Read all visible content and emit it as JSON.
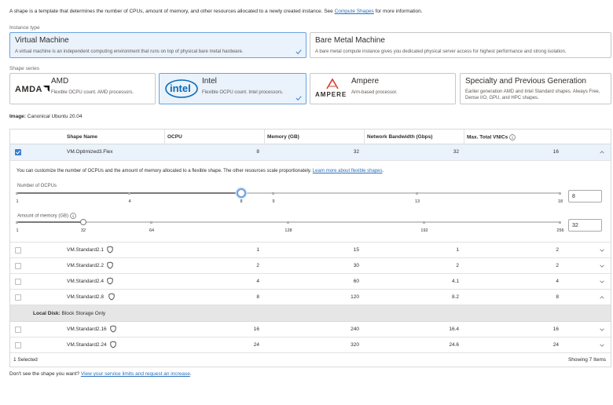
{
  "intro": {
    "text": "A shape is a template that determines the number of CPUs, amount of memory, and other resources allocated to a newly created instance. See ",
    "link": "Compute Shapes",
    "suffix": " for more information."
  },
  "instance_type": {
    "label": "Instance type",
    "options": [
      {
        "title": "Virtual Machine",
        "desc": "A virtual machine is an independent computing environment that runs on top of physical bare metal hardware.",
        "selected": true
      },
      {
        "title": "Bare Metal Machine",
        "desc": "A bare metal compute instance gives you dedicated physical server access for highest performance and strong isolation.",
        "selected": false
      }
    ]
  },
  "shape_series": {
    "label": "Shape series",
    "options": [
      {
        "logo": "AMDA",
        "title": "AMD",
        "desc": "Flexible OCPU count. AMD processors.",
        "selected": false
      },
      {
        "logo": "intel",
        "title": "Intel",
        "desc": "Flexible OCPU count. Intel processors.",
        "selected": true
      },
      {
        "logo": "AMPERE",
        "title": "Ampere",
        "desc": "Arm-based processor.",
        "selected": false
      },
      {
        "logo": "",
        "title": "Specialty and Previous Generation",
        "desc": "Earlier generation AMD and Intel Standard shapes. Always Free, Dense I/O, GPU, and HPC shapes.",
        "selected": false
      }
    ]
  },
  "image": {
    "label": "Image:",
    "value": "Canonical Ubuntu 20.04"
  },
  "table": {
    "headers": [
      "Shape Name",
      "OCPU",
      "Memory (GB)",
      "Network Bandwidth (Gbps)",
      "Max. Total VNICs"
    ],
    "flex_row": {
      "name": "VM.Optimized3.Flex",
      "ocpu": "8",
      "memory": "32",
      "bandwidth": "32",
      "vnics": "16"
    },
    "flex_desc": "You can customize the number of OCPUs and the amount of memory allocated to a flexible shape. The other resources scale proportionately. ",
    "flex_link": "Learn more about flexible shapes",
    "ocpu_slider": {
      "label": "Number of OCPUs",
      "ticks": [
        "1",
        "4",
        "8",
        "9",
        "13",
        "18"
      ],
      "value": "8",
      "fraction": 0.41
    },
    "memory_slider": {
      "label": "Amount of memory (GB)",
      "ticks": [
        "1",
        "32",
        "64",
        "128",
        "192",
        "256"
      ],
      "value": "32",
      "fraction": 0.121
    },
    "rows": [
      {
        "name": "VM.Standard2.1",
        "ocpu": "1",
        "memory": "15",
        "bandwidth": "1",
        "vnics": "2",
        "chev": "down"
      },
      {
        "name": "VM.Standard2.2",
        "ocpu": "2",
        "memory": "30",
        "bandwidth": "2",
        "vnics": "2",
        "chev": "down"
      },
      {
        "name": "VM.Standard2.4",
        "ocpu": "4",
        "memory": "60",
        "bandwidth": "4.1",
        "vnics": "4",
        "chev": "down"
      },
      {
        "name": "VM.Standard2.8",
        "ocpu": "8",
        "memory": "120",
        "bandwidth": "8.2",
        "vnics": "8",
        "chev": "up"
      }
    ],
    "local_disk": {
      "label": "Local Disk:",
      "value": "Block Storage Only"
    },
    "rows2": [
      {
        "name": "VM.Standard2.16",
        "ocpu": "16",
        "memory": "240",
        "bandwidth": "16.4",
        "vnics": "16",
        "chev": "down"
      },
      {
        "name": "VM.Standard2.24",
        "ocpu": "24",
        "memory": "320",
        "bandwidth": "24.6",
        "vnics": "24",
        "chev": "down"
      }
    ],
    "selected_count": "1 Selected",
    "showing": "Showing 7 Items"
  },
  "bottom": {
    "text": "Don't see the shape you want? ",
    "link": "View your service limits and request an increase",
    "suffix": "."
  },
  "colors": {
    "accent": "#3b7ecf",
    "selected_bg": "#eaf2fb",
    "link": "#2a6ebb"
  }
}
